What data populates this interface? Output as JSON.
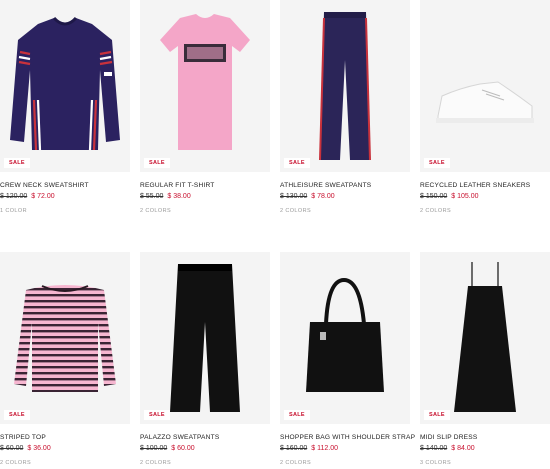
{
  "products": [
    {
      "name": "CREW NECK SWEATSHIRT",
      "badge": "SALE",
      "old_price": "$ 120.00",
      "new_price": "$ 72.00",
      "colors": "1 COLOR",
      "image": "navy-sweatshirt"
    },
    {
      "name": "REGULAR FIT T-SHIRT",
      "badge": "SALE",
      "old_price": "$ 55.00",
      "new_price": "$ 38.00",
      "colors": "2 COLORS",
      "image": "pink-tshirt"
    },
    {
      "name": "ATHLEISURE SWEATPANTS",
      "badge": "SALE",
      "old_price": "$ 130.00",
      "new_price": "$ 78.00",
      "colors": "2 COLORS",
      "image": "navy-sweatpants"
    },
    {
      "name": "RECYCLED LEATHER SNEAKERS",
      "badge": "SALE",
      "old_price": "$ 150.00",
      "new_price": "$ 105.00",
      "colors": "2 COLORS",
      "image": "white-sneaker"
    },
    {
      "name": "STRIPED TOP",
      "badge": "SALE",
      "old_price": "$ 60.00",
      "new_price": "$ 36.00",
      "colors": "2 COLORS",
      "image": "striped-top"
    },
    {
      "name": "PALAZZO SWEATPANTS",
      "badge": "SALE",
      "old_price": "$ 100.00",
      "new_price": "$ 60.00",
      "colors": "2 COLORS",
      "image": "black-palazzo"
    },
    {
      "name": "SHOPPER BAG WITH SHOULDER STRAP",
      "badge": "SALE",
      "old_price": "$ 160.00",
      "new_price": "$ 112.00",
      "colors": "2 COLORS",
      "image": "black-bag"
    },
    {
      "name": "MIDI SLIP DRESS",
      "badge": "SALE",
      "old_price": "$ 140.00",
      "new_price": "$ 84.00",
      "colors": "3 COLORS",
      "image": "black-dress"
    }
  ],
  "colors": {
    "sale_red": "#c8102e",
    "tile_bg": "#f4f4f4"
  }
}
